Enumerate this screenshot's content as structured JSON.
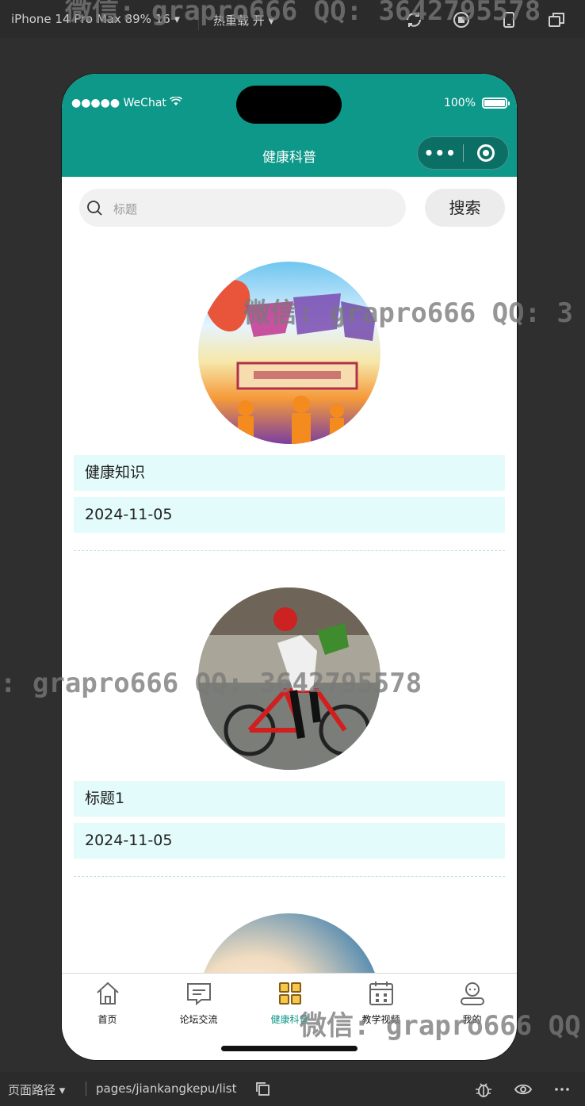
{
  "simulator": {
    "device": "iPhone 14 Pro Max 89% 16 ▾",
    "hot_reload": "热重载 开 ▾",
    "path_label": "页面路径 ▾",
    "path": "pages/jiankangkepu/list"
  },
  "watermark": {
    "text_top": "微信: grapro666 QQ: 3642795578",
    "text_1": "微信: grapro666 QQ: 3",
    "text_2": ": grapro666 QQ: 3642795578",
    "text_3": "微信: grapro666 QQ"
  },
  "status_bar": {
    "carrier": "●●●●● WeChat",
    "battery": "100%"
  },
  "navbar": {
    "title": "健康科普",
    "more_icon": "more-dots-icon",
    "close_icon": "target-circle-icon"
  },
  "search": {
    "placeholder": "标题",
    "button_label": "搜索"
  },
  "items": [
    {
      "title": "健康知识",
      "date": "2024-11-05",
      "image": "mental-health-poster"
    },
    {
      "title": "标题1",
      "date": "2024-11-05",
      "image": "cyclist-photo"
    },
    {
      "title": "",
      "date": "",
      "image": "sky-gradient"
    }
  ],
  "tabbar": {
    "tabs": [
      {
        "label": "首页",
        "icon": "home-icon",
        "active": false
      },
      {
        "label": "论坛交流",
        "icon": "chat-icon",
        "active": false
      },
      {
        "label": "健康科普",
        "icon": "grid-icon",
        "active": true
      },
      {
        "label": "教学视频",
        "icon": "calendar-icon",
        "active": false
      },
      {
        "label": "我的",
        "icon": "user-icon",
        "active": false
      }
    ]
  },
  "colors": {
    "primary": "#0d9889",
    "info_bg": "#e3fbfa",
    "active_tab_icon": "#d4a21a"
  }
}
